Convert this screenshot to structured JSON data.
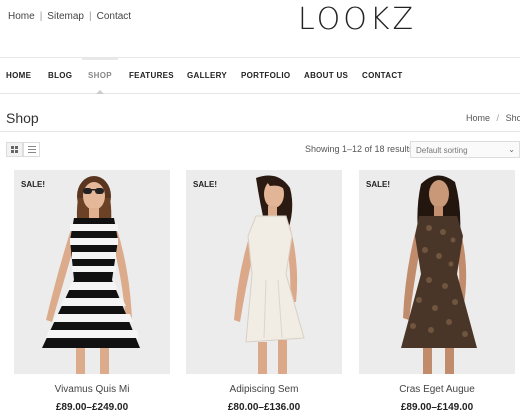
{
  "top_links": [
    "Home",
    "Sitemap",
    "Contact"
  ],
  "top_link_separator": "|",
  "logo": "LOOKZ",
  "nav": {
    "items": [
      "HOME",
      "BLOG",
      "SHOP",
      "FEATURES",
      "GALLERY",
      "PORTFOLIO",
      "ABOUT US",
      "CONTACT"
    ],
    "active": "SHOP"
  },
  "page": {
    "title": "Shop",
    "breadcrumb": [
      "Home",
      "Shop"
    ],
    "breadcrumb_separator": "/"
  },
  "toolbar": {
    "result_count": "Showing 1–12 of 18 results",
    "sort_value": "Default sorting",
    "views": [
      "grid-view-icon",
      "list-view-icon"
    ],
    "active_view": "grid"
  },
  "products": [
    {
      "name": "Vivamus Quis Mi",
      "price": "£89.00–£249.00",
      "badge": "SALE!",
      "image": "model-striped-dress"
    },
    {
      "name": "Adipiscing Sem",
      "price": "£80.00–£136.00",
      "badge": "SALE!",
      "image": "model-white-dress"
    },
    {
      "name": "Cras Eget Augue",
      "price": "£89.00–£149.00",
      "badge": "SALE!",
      "image": "model-lace-dress"
    }
  ],
  "colors": {
    "text": "#333333",
    "nav_active": "#888888",
    "image_bg": "#ececec",
    "border": "#e6e6e6"
  }
}
